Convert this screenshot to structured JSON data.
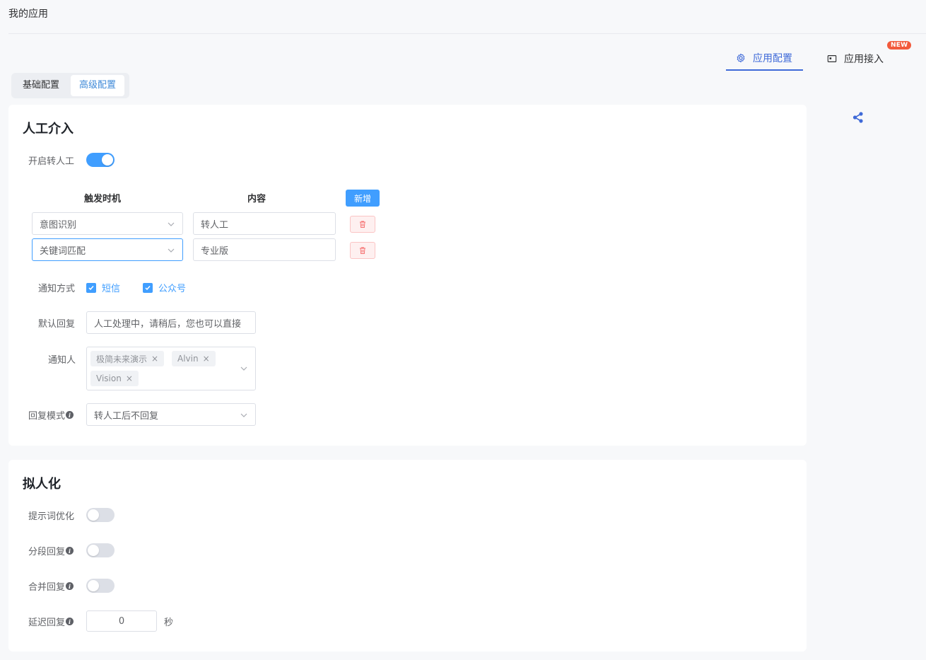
{
  "page": {
    "title": "我的应用"
  },
  "top_tabs": {
    "config": {
      "label": "应用配置",
      "icon": "gear-icon"
    },
    "access": {
      "label": "应用接入",
      "icon": "embed-icon",
      "badge": "NEW"
    }
  },
  "seg_tabs": {
    "basic": "基础配置",
    "advanced": "高级配置"
  },
  "handover": {
    "title": "人工介入",
    "enable_label": "开启转人工",
    "enabled": true,
    "col_trigger": "触发时机",
    "col_content": "内容",
    "add_label": "新增",
    "rows": [
      {
        "trigger": "意图识别",
        "content": "转人工"
      },
      {
        "trigger": "关键词匹配",
        "content": "专业版"
      }
    ],
    "notify_method_label": "通知方式",
    "methods": {
      "sms": "短信",
      "wechat": "公众号"
    },
    "default_reply_label": "默认回复",
    "default_reply_value": "人工处理中，请稍后，您也可以直接",
    "notify_people_label": "通知人",
    "people": [
      "极简未来演示",
      "Alvin",
      "Vision"
    ],
    "reply_mode_label": "回复模式",
    "reply_mode_value": "转人工后不回复"
  },
  "persona": {
    "title": "拟人化",
    "prompt_opt_label": "提示词优化",
    "segment_reply_label": "分段回复",
    "merge_reply_label": "合并回复",
    "delay_reply_label": "延迟回复",
    "delay_value": "0",
    "delay_unit": "秒"
  },
  "colors": {
    "primary": "#409eff",
    "accent": "#3f6ad8",
    "badge": "#f25a3c",
    "danger": "#f56c6c"
  }
}
